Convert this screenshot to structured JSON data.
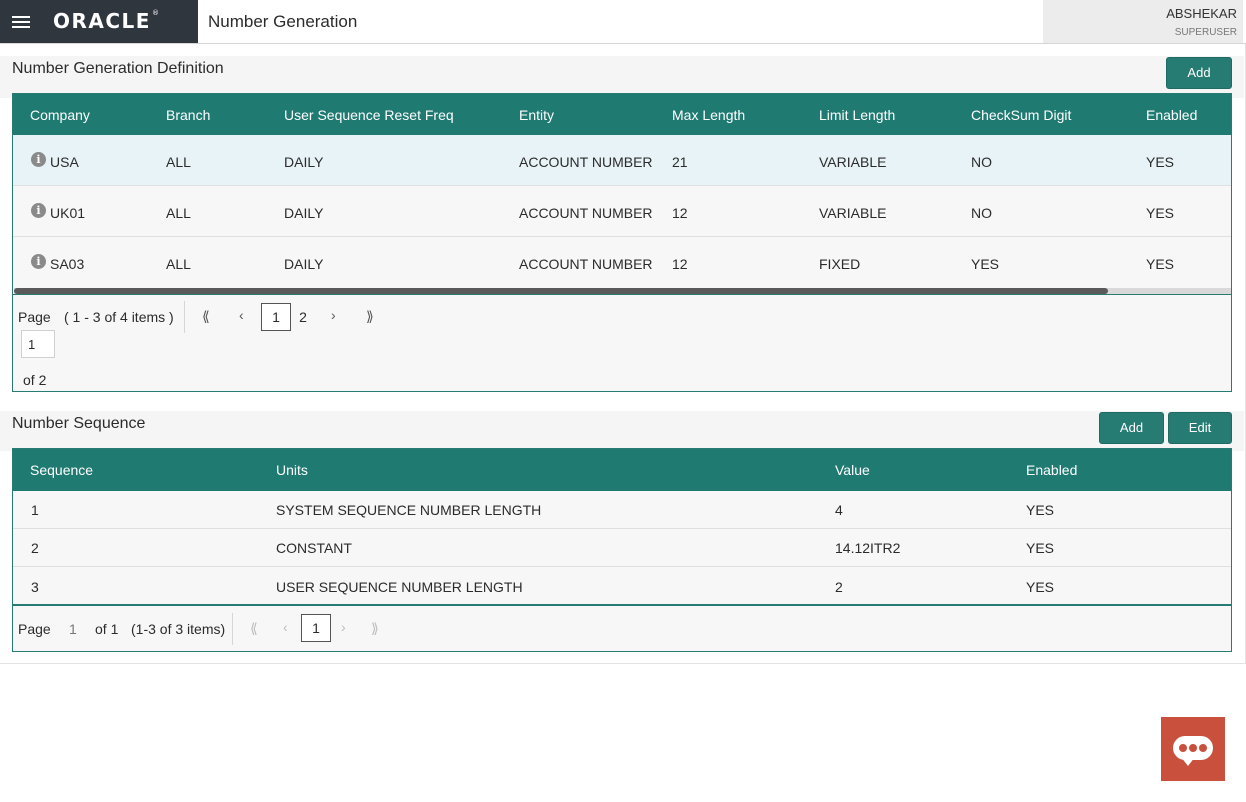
{
  "header": {
    "logo": "ORACLE",
    "logo_mark": "®",
    "title": "Number Generation",
    "user_name": "ABSHEKAR",
    "user_role": "SUPERUSER"
  },
  "definition": {
    "title": "Number Generation Definition",
    "add_label": "Add",
    "columns": [
      "Company",
      "Branch",
      "User Sequence Reset Freq",
      "Entity",
      "Max Length",
      "Limit Length",
      "CheckSum Digit",
      "Enabled"
    ],
    "rows": [
      [
        "USA",
        "ALL",
        "DAILY",
        "ACCOUNT NUMBER",
        "21",
        "VARIABLE",
        "NO",
        "YES"
      ],
      [
        "UK01",
        "ALL",
        "DAILY",
        "ACCOUNT NUMBER",
        "12",
        "VARIABLE",
        "NO",
        "YES"
      ],
      [
        "SA03",
        "ALL",
        "DAILY",
        "ACCOUNT NUMBER",
        "12",
        "FIXED",
        "YES",
        "YES"
      ]
    ],
    "pager": {
      "page_label": "Page",
      "items_text": "( 1 - 3 of 4 items )",
      "pages": [
        "1",
        "2"
      ],
      "current_page_input": "1",
      "of_text": "of 2"
    }
  },
  "sequence": {
    "title": "Number Sequence",
    "add_label": "Add",
    "edit_label": "Edit",
    "columns": [
      "Sequence",
      "Units",
      "Value",
      "Enabled"
    ],
    "rows": [
      [
        "1",
        "SYSTEM SEQUENCE NUMBER LENGTH",
        "4",
        "YES"
      ],
      [
        "2",
        "CONSTANT",
        "14.12ITR2",
        "YES"
      ],
      [
        "3",
        "USER SEQUENCE NUMBER LENGTH",
        "2",
        "YES"
      ]
    ],
    "pager": {
      "page_label": "Page",
      "current": "1",
      "of_text": "of 1",
      "items_text": "(1-3 of 3 items)",
      "pages": [
        "1"
      ]
    }
  },
  "icons": {
    "menu": "hamburger-icon",
    "info": "info-icon",
    "first": "⟪",
    "prev": "‹",
    "next": "›",
    "last": "⟫",
    "chat": "chat-bubble-icon"
  },
  "colors": {
    "primary": "#267b73",
    "header_dark": "#2f363e",
    "chat_fab": "#c9503c",
    "selected_row": "#e8f3f8"
  }
}
